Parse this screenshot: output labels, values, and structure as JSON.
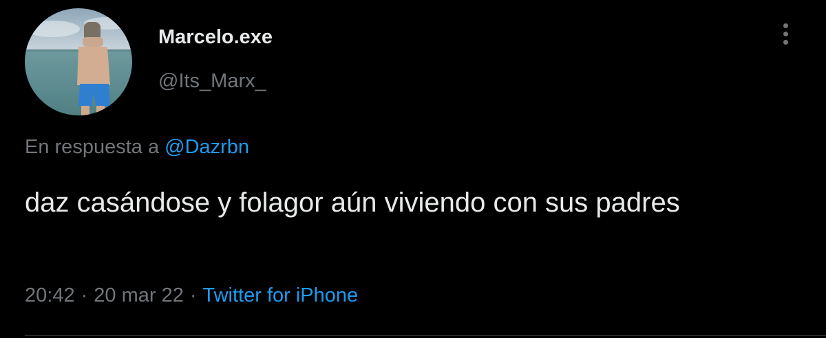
{
  "author": {
    "display_name": "Marcelo.exe",
    "handle": "@Its_Marx_"
  },
  "reply": {
    "prefix": "En respuesta a",
    "mention": "@Dazrbn"
  },
  "tweet": {
    "text": "daz casándose y folagor aún viviendo con sus padres"
  },
  "meta": {
    "time": "20:42",
    "separator": "·",
    "date": "20 mar 22",
    "source": "Twitter for iPhone"
  },
  "icons": {
    "more": "more-vertical-icon"
  },
  "colors": {
    "background": "#000000",
    "text_primary": "#e7e9ea",
    "text_secondary": "#71767b",
    "link": "#1d9bf0"
  }
}
